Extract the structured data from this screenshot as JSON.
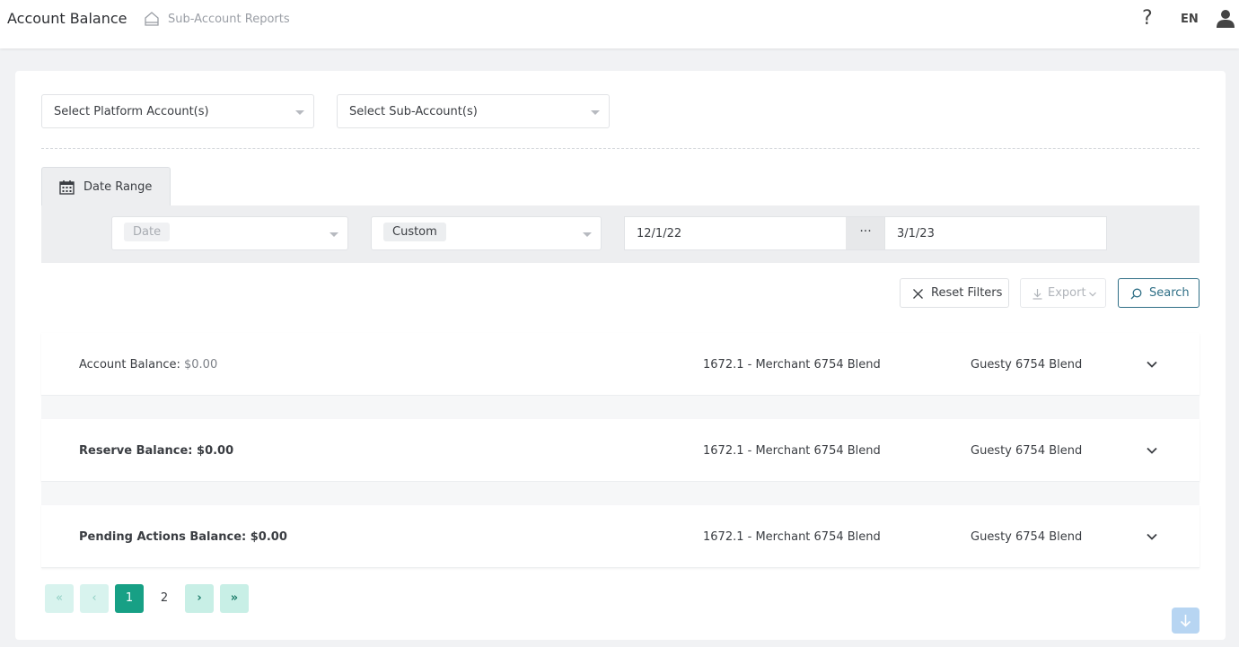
{
  "header": {
    "title": "Account Balance",
    "breadcrumb": "Sub-Account Reports",
    "help": "?",
    "language": "EN",
    "icons": [
      "home-icon",
      "help-icon",
      "user-icon"
    ]
  },
  "filters": {
    "platform_account_placeholder": "Select Platform Account(s)",
    "sub_account_placeholder": "Select Sub-Account(s)",
    "tab_label": "Date Range",
    "date_field": "Date",
    "date_mode": "Custom",
    "start_date": "12/1/22",
    "range_separator": "···",
    "end_date": "3/1/23"
  },
  "actions": {
    "reset": "Reset Filters",
    "export": "Export",
    "search": "Search"
  },
  "rows": [
    {
      "label": "Account Balance:",
      "amount": "$0.00",
      "merchant": "1672.1 - Merchant 6754 Blend",
      "name": "Guesty 6754 Blend"
    },
    {
      "label": "Reserve Balance:",
      "amount": "$0.00",
      "merchant": "1672.1 - Merchant 6754 Blend",
      "name": "Guesty 6754 Blend"
    },
    {
      "label": "Pending Actions Balance:",
      "amount": "$0.00",
      "merchant": "1672.1 - Merchant 6754 Blend",
      "name": "Guesty 6754 Blend"
    }
  ],
  "pagination": {
    "first": "«",
    "prev": "‹",
    "pages": [
      "1",
      "2"
    ],
    "current": "1",
    "next": "›",
    "last": "»"
  },
  "colors": {
    "accent": "#17a085",
    "search_border": "#2f6f86",
    "scroll_top": "#b7d5f2"
  }
}
